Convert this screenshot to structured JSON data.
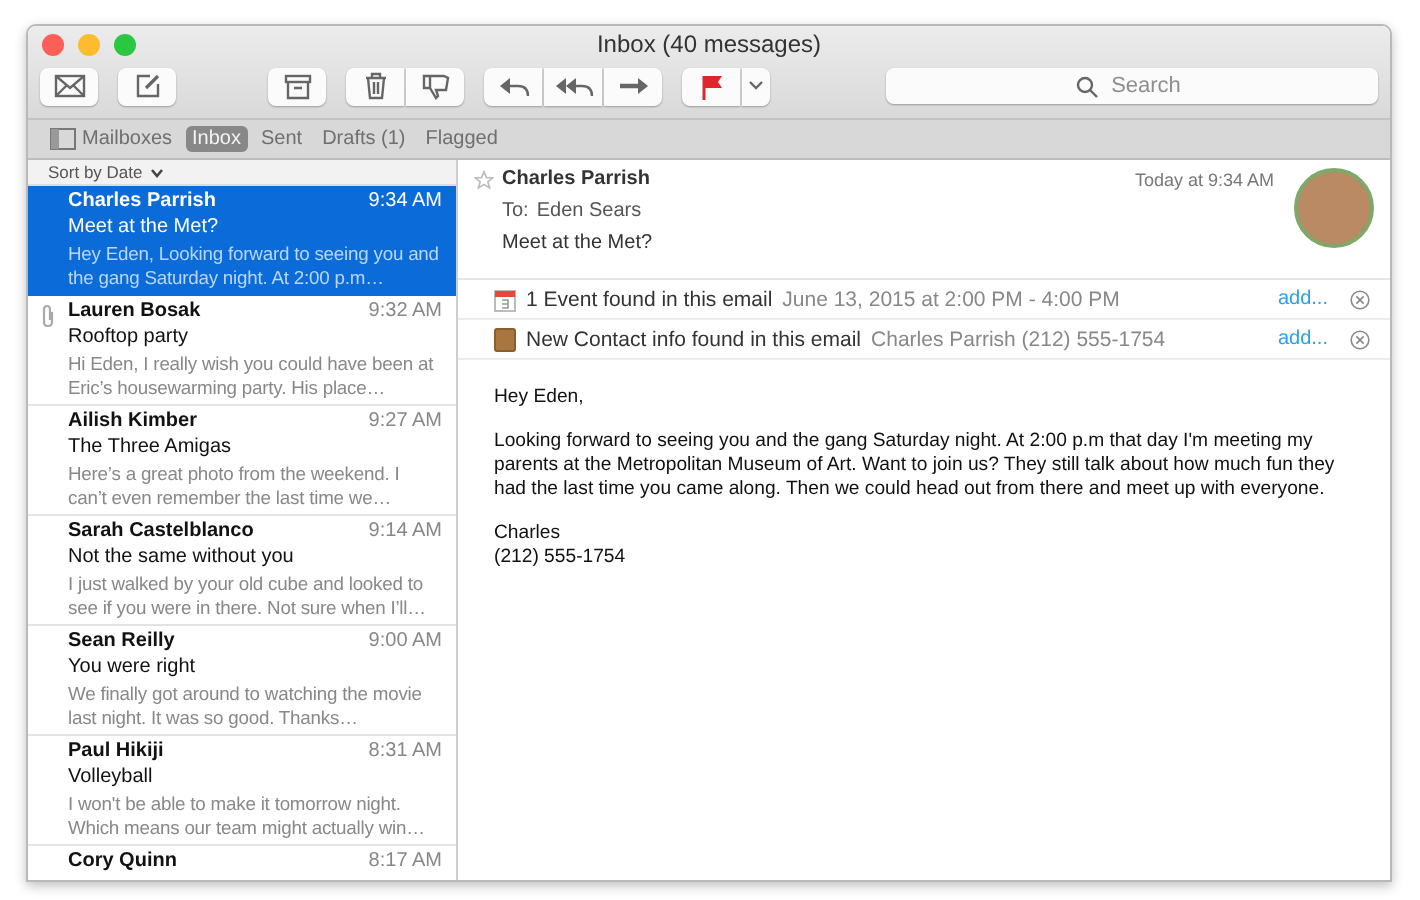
{
  "window": {
    "title": "Inbox (40 messages)"
  },
  "toolbar": {
    "search": {
      "placeholder": "Search"
    }
  },
  "favorites": [
    {
      "label": "Mailboxes",
      "kind": "sidebar",
      "selected": false
    },
    {
      "label": "Inbox",
      "kind": "plain",
      "selected": true
    },
    {
      "label": "Sent",
      "kind": "plain",
      "selected": false
    },
    {
      "label": "Drafts (1)",
      "kind": "plain",
      "selected": false
    },
    {
      "label": "Flagged",
      "kind": "plain",
      "selected": false
    }
  ],
  "message_list": {
    "sort": "Sort by Date",
    "messages": [
      {
        "sender": "Charles Parrish",
        "time": "9:34 AM",
        "subject": "Meet at the Met?",
        "preview": "Hey Eden, Looking forward to seeing you and the gang Saturday night. At 2:00 p.m…",
        "attachment": false,
        "selected": true
      },
      {
        "sender": "Lauren Bosak",
        "time": "9:32 AM",
        "subject": "Rooftop party",
        "preview": "Hi Eden, I really wish you could have been at Eric’s housewarming party. His place…",
        "attachment": true,
        "selected": false
      },
      {
        "sender": "Ailish Kimber",
        "time": "9:27 AM",
        "subject": "The Three Amigas",
        "preview": "Here’s a great photo from the weekend. I can’t even remember the last time we…",
        "attachment": false,
        "selected": false
      },
      {
        "sender": "Sarah Castelblanco",
        "time": "9:14 AM",
        "subject": "Not the same without you",
        "preview": "I just walked by your old cube and looked to see if you were in there. Not sure when I’ll…",
        "attachment": false,
        "selected": false
      },
      {
        "sender": "Sean Reilly",
        "time": "9:00 AM",
        "subject": "You were right",
        "preview": "We finally got around to watching the movie last night. It was so good. Thanks…",
        "attachment": false,
        "selected": false
      },
      {
        "sender": "Paul Hikiji",
        "time": "8:31 AM",
        "subject": "Volleyball",
        "preview": "I won't be able to make it tomorrow night. Which means our team might actually win…",
        "attachment": false,
        "selected": false
      },
      {
        "sender": "Cory Quinn",
        "time": "8:17 AM",
        "attachment": false,
        "selected": false
      }
    ]
  },
  "message": {
    "from": "Charles Parrish",
    "date": "Today at 9:34 AM",
    "to_label": "To:",
    "to": "Eden Sears",
    "subject": "Meet at the Met?",
    "flagged": false,
    "suggestions": [
      {
        "kind": "event",
        "title": "1 Event found in this email",
        "detail": "June 13, 2015 at 2:00 PM - 4:00 PM",
        "action": "add..."
      },
      {
        "kind": "contact",
        "title": "New Contact info found in this email",
        "detail": "Charles Parrish (212) 555-1754",
        "action": "add..."
      }
    ],
    "body": [
      "Hey Eden,",
      "Looking forward to seeing you and the gang Saturday night. At 2:00 p.m that day I'm meeting my parents at the Metropolitan Museum of Art. Want to join us? They still talk about how much fun they had the last time you came along. Then we could head out from there and meet up with everyone."
    ],
    "signature": [
      "Charles",
      "(212) 555-1754"
    ]
  }
}
